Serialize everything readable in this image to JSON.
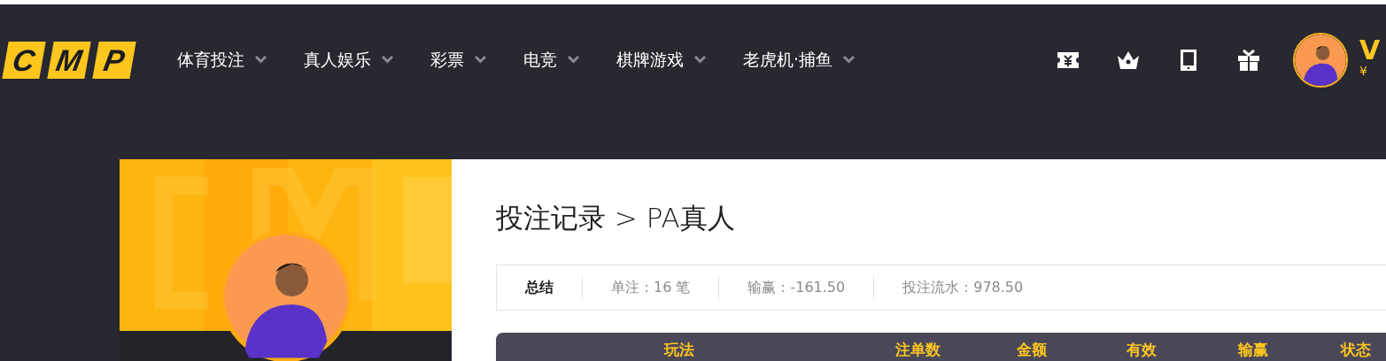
{
  "logo": {
    "letters": [
      "C",
      "M",
      "P"
    ]
  },
  "nav": [
    {
      "label": "体育投注",
      "has_menu": true
    },
    {
      "label": "真人娱乐",
      "has_menu": true
    },
    {
      "label": "彩票",
      "has_menu": true
    },
    {
      "label": "电竞",
      "has_menu": true
    },
    {
      "label": "棋牌游戏",
      "has_menu": true
    },
    {
      "label": "老虎机·捕鱼",
      "has_menu": true
    }
  ],
  "toolbar": [
    {
      "kind": "ticket"
    },
    {
      "kind": "crown"
    },
    {
      "kind": "tablet"
    },
    {
      "kind": "gift"
    }
  ],
  "user": {
    "name": "V",
    "balance": "¥"
  },
  "page_title": "投注记录 > PA真人",
  "summary": [
    {
      "label": "总结",
      "selected": true
    },
    {
      "label": "单注：16 笔",
      "selected": false
    },
    {
      "label": "输赢：-161.50",
      "selected": false
    },
    {
      "label": "投注流水：978.50",
      "selected": false
    }
  ],
  "table": {
    "columns": [
      "玩法",
      "注单数",
      "金额",
      "有效",
      "输赢",
      "状态"
    ]
  }
}
